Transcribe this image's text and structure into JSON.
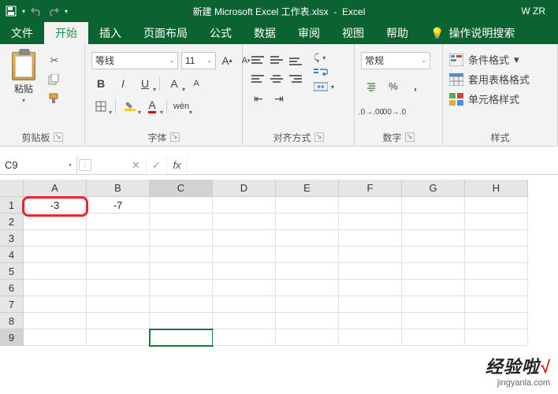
{
  "title": {
    "doc": "新建 Microsoft Excel 工作表.xlsx",
    "app": "Excel",
    "user": "W ZR"
  },
  "tabs": {
    "file": "文件",
    "home": "开始",
    "insert": "插入",
    "layout": "页面布局",
    "formulas": "公式",
    "data": "数据",
    "review": "审阅",
    "view": "视图",
    "help": "帮助",
    "tell": "操作说明搜索"
  },
  "clipboard": {
    "paste": "粘贴",
    "title": "剪贴板"
  },
  "font": {
    "name": "等线",
    "size": "11",
    "title": "字体",
    "bold": "B",
    "italic": "I",
    "underline": "U",
    "phonetic": "wén",
    "A": "A"
  },
  "align": {
    "title": "对齐方式"
  },
  "number": {
    "format": "常规",
    "title": "数字",
    "percent": "%",
    "comma": ",",
    "inc": ".0",
    "dec": ".00"
  },
  "styles": {
    "cond": "条件格式",
    "table": "套用表格格式",
    "cell": "单元格样式",
    "title": "样式"
  },
  "namebox": "C9",
  "fx": "fx",
  "cols": [
    "A",
    "B",
    "C",
    "D",
    "E",
    "F",
    "G",
    "H"
  ],
  "cells": {
    "A1": "-3",
    "B1": "-7"
  },
  "watermark": {
    "brand": "经验啦",
    "check": "√",
    "url": "jingyanla.com"
  }
}
